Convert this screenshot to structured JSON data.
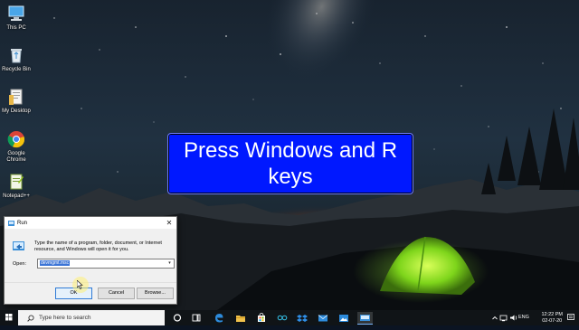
{
  "desktop": {
    "icons": [
      {
        "label": "This PC",
        "icon": "computer-icon"
      },
      {
        "label": "Recycle Bin",
        "icon": "recycle-bin-icon"
      },
      {
        "label": "My Desktop",
        "icon": "folder-icon"
      },
      {
        "label": "Google Chrome",
        "icon": "chrome-icon"
      },
      {
        "label": "Notepad++",
        "icon": "notepad-plus-plus-icon"
      }
    ]
  },
  "caption": {
    "text": "Press Windows and R keys",
    "bg_color": "#0018ff"
  },
  "run_dialog": {
    "title": "Run",
    "description": "Type the name of a program, folder, document, or Internet resource, and Windows will open it for you.",
    "open_label": "Open:",
    "open_value": "devmgmt.msc",
    "ok_label": "OK",
    "cancel_label": "Cancel",
    "browse_label": "Browse..."
  },
  "taskbar": {
    "search_placeholder": "Type here to search",
    "apps": [
      "cortana-icon",
      "task-view-icon",
      "edge-icon",
      "file-explorer-icon",
      "store-icon",
      "people-icon",
      "dropbox-icon",
      "mail-icon",
      "photos-icon",
      "run-icon"
    ],
    "language": "ENG",
    "time": "12:22 PM",
    "date": "02-07-20"
  }
}
